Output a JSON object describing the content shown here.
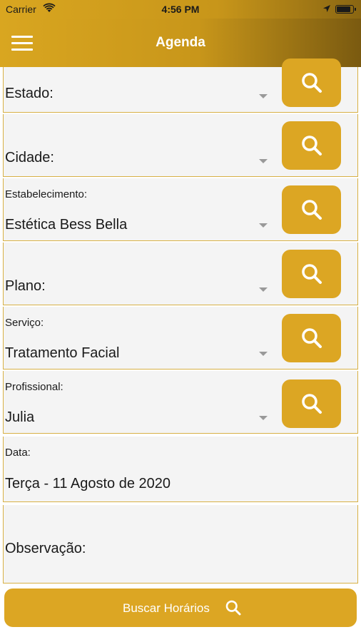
{
  "status": {
    "carrier": "Carrier",
    "time": "4:56 PM",
    "battery_level": 0.9
  },
  "header": {
    "title": "Agenda"
  },
  "form": {
    "estado": {
      "label": "",
      "value": "Estado:"
    },
    "cidade": {
      "label": "",
      "value": "Cidade:"
    },
    "estabelecimento": {
      "label": "Estabelecimento:",
      "value": "Estética Bess Bella"
    },
    "plano": {
      "label": "",
      "value": "Plano:"
    },
    "servico": {
      "label": "Serviço:",
      "value": "Tratamento Facial"
    },
    "profissional": {
      "label": "Profissional:",
      "value": "Julia"
    },
    "data": {
      "label": "Data:",
      "value": "Terça - 11 Agosto de 2020"
    },
    "observacao": {
      "label": "",
      "value": "Observação:"
    }
  },
  "actions": {
    "buscar_label": "Buscar Horários"
  },
  "colors": {
    "accent": "#dca623",
    "field_bg": "#f4f4f4",
    "field_border": "#d7b045"
  }
}
